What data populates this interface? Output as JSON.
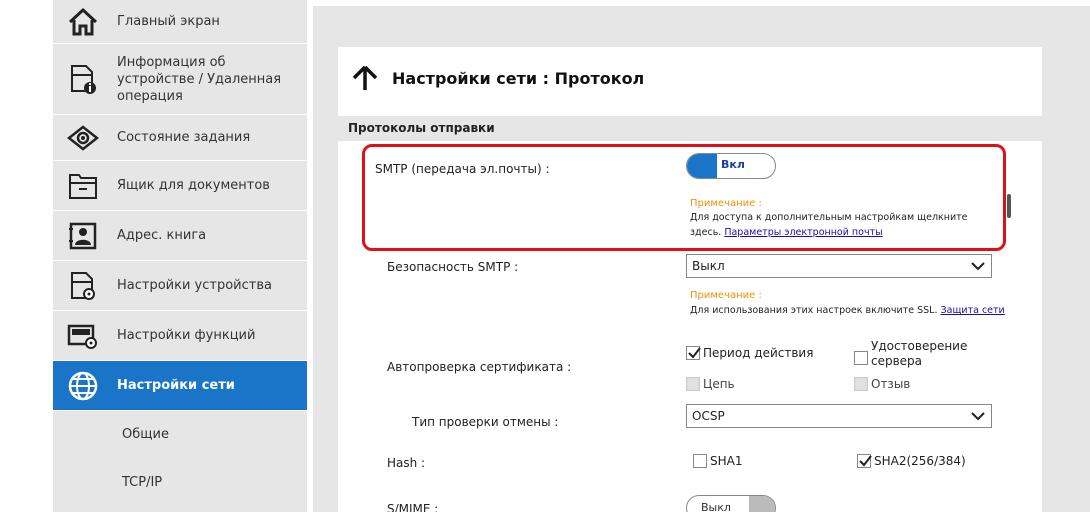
{
  "sidebar": {
    "items": [
      {
        "label": "Главный экран",
        "icon": "home-icon"
      },
      {
        "label": "Информация об устройстве / Удаленная операция",
        "icon": "device-info-icon"
      },
      {
        "label": "Состояние задания",
        "icon": "eye-icon"
      },
      {
        "label": "Ящик для документов",
        "icon": "document-box-icon"
      },
      {
        "label": "Адрес. книга",
        "icon": "address-book-icon"
      },
      {
        "label": "Настройки устройства",
        "icon": "device-settings-icon"
      },
      {
        "label": "Настройки функций",
        "icon": "function-settings-icon"
      },
      {
        "label": "Настройки сети",
        "icon": "globe-icon",
        "active": true
      }
    ],
    "subitems": [
      "Общие",
      "TCP/IP"
    ]
  },
  "page": {
    "title": "Настройки сети : Протокол",
    "section": "Протоколы отправки"
  },
  "smtp": {
    "label": "SMTP (передача эл.почты) :",
    "toggle": "Вкл",
    "note_title": "Примечание :",
    "note_text": "Для доступа к дополнительным настройкам щелкните здесь.",
    "note_link": "Параметры электронной почты"
  },
  "smtp_security": {
    "label": "Безопасность SMTP :",
    "value": "Выкл",
    "note_title": "Примечание :",
    "note_text": "Для использования этих настроек включите SSL.",
    "note_link": "Защита сети"
  },
  "cert_check": {
    "label": "Автопроверка сертификата :",
    "period": "Период действия",
    "server": "Удостоверение сервера",
    "chain": "Цепь",
    "revoke": "Отзыв"
  },
  "revoke_type": {
    "label": "Тип проверки отмены :",
    "value": "OCSP"
  },
  "hash": {
    "label": "Hash :",
    "sha1": "SHA1",
    "sha2": "SHA2(256/384)"
  },
  "smime": {
    "label": "S/MIME :",
    "toggle": "Выкл"
  },
  "colors": {
    "accent": "#1a75c8",
    "highlight": "#e0101a",
    "note": "#f29100"
  }
}
